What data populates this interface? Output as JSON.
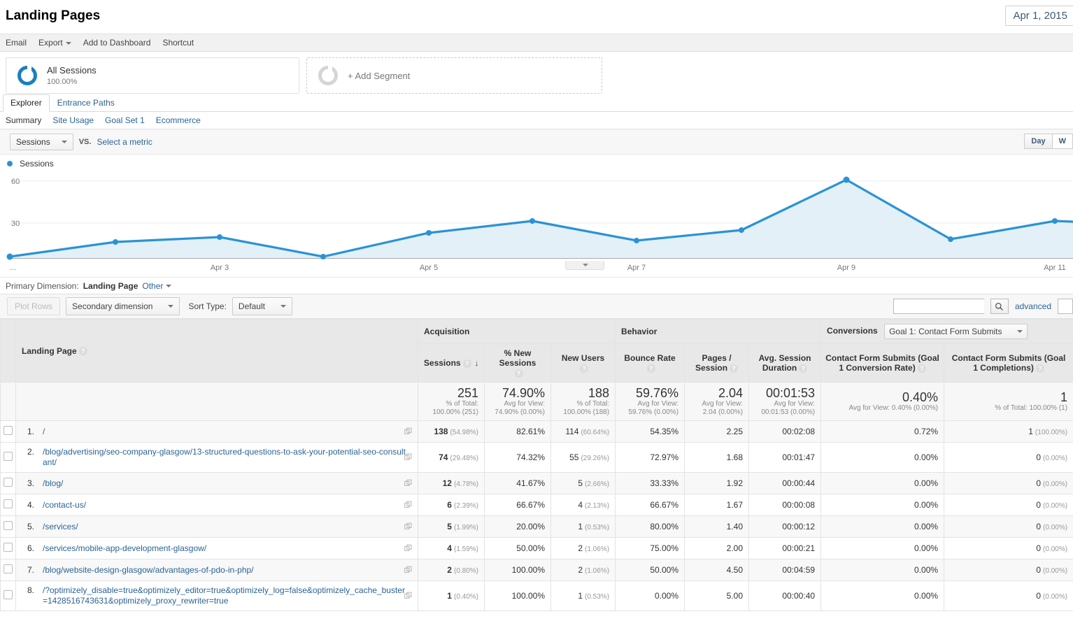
{
  "header": {
    "title": "Landing Pages",
    "date_range": "Apr 1, 2015"
  },
  "actions": [
    {
      "label": "Email",
      "icon": ""
    },
    {
      "label": "Export",
      "icon": "caret-down"
    },
    {
      "label": "Add to Dashboard",
      "icon": ""
    },
    {
      "label": "Shortcut",
      "icon": ""
    }
  ],
  "segments": {
    "all_sessions": {
      "name": "All Sessions",
      "percent": "100.00%"
    },
    "add_segment": {
      "label": "+ Add Segment"
    }
  },
  "tabs": [
    {
      "label": "Explorer",
      "active": true
    },
    {
      "label": "Entrance Paths",
      "active": false
    }
  ],
  "subtabs": [
    {
      "label": "Summary",
      "active": true
    },
    {
      "label": "Site Usage",
      "active": false
    },
    {
      "label": "Goal Set 1",
      "active": false
    },
    {
      "label": "Ecommerce",
      "active": false
    }
  ],
  "metric_bar": {
    "metric": "Sessions",
    "vs": "VS.",
    "select_metric": "Select a metric",
    "granularity": [
      {
        "label": "Day",
        "active": true
      },
      {
        "label": "W",
        "active": false
      }
    ]
  },
  "chart_data": {
    "type": "line",
    "title": "Sessions",
    "legend": [
      "Sessions"
    ],
    "legend_position": "top-left",
    "xlabel": "",
    "ylabel": "",
    "ylim": [
      0,
      75
    ],
    "yticks": [
      30,
      60
    ],
    "grid": true,
    "x": [
      "Apr 1",
      "Apr 2",
      "Apr 3",
      "Apr 4",
      "Apr 5",
      "Apr 6",
      "Apr 7",
      "Apr 8",
      "Apr 9",
      "Apr 10",
      "Apr 11"
    ],
    "xtick_labels": [
      "...",
      "Apr 3",
      "Apr 5",
      "Apr 7",
      "Apr 9",
      "Apr 11"
    ],
    "series": [
      {
        "name": "Sessions",
        "color": "#2a93d5",
        "values": [
          1,
          13,
          17,
          1,
          20,
          29,
          14,
          23,
          56,
          15,
          28
        ]
      }
    ]
  },
  "primary_dimension": {
    "label": "Primary Dimension:",
    "value": "Landing Page",
    "other": "Other"
  },
  "table_toolbar": {
    "plot_rows": "Plot Rows",
    "secondary_dimension": "Secondary dimension",
    "sort_type_label": "Sort Type:",
    "sort_type_value": "Default",
    "search_placeholder": "",
    "search_value": "",
    "advanced": "advanced"
  },
  "table": {
    "groups": [
      {
        "label": "Acquisition",
        "span": 3
      },
      {
        "label": "Behavior",
        "span": 3
      },
      {
        "label": "Conversions",
        "span": 2,
        "goal_select": "Goal 1: Contact Form Submits"
      }
    ],
    "dimension_header": "Landing Page",
    "columns": [
      "Sessions",
      "% New Sessions",
      "New Users",
      "Bounce Rate",
      "Pages / Session",
      "Avg. Session Duration",
      "Contact Form Submits (Goal 1 Conversion Rate)",
      "Contact Form Submits (Goal 1 Completions)"
    ],
    "sorted_column": "Sessions",
    "sort_direction": "desc",
    "summary": [
      {
        "value": "251",
        "note1": "% of Total:",
        "note2": "100.00% (251)"
      },
      {
        "value": "74.90%",
        "note1": "Avg for View:",
        "note2": "74.90% (0.00%)"
      },
      {
        "value": "188",
        "note1": "% of Total:",
        "note2": "100.00% (188)"
      },
      {
        "value": "59.76%",
        "note1": "Avg for View:",
        "note2": "59.76% (0.00%)"
      },
      {
        "value": "2.04",
        "note1": "Avg for View:",
        "note2": "2.04 (0.00%)"
      },
      {
        "value": "00:01:53",
        "note1": "Avg for View:",
        "note2": "00:01:53 (0.00%)"
      },
      {
        "value": "0.40%",
        "note1": "",
        "note2": "Avg for View: 0.40% (0.00%)"
      },
      {
        "value": "1",
        "note1": "",
        "note2": "% of Total: 100.00% (1)"
      }
    ],
    "rows": [
      {
        "index": "1.",
        "page": "/",
        "sessions": "138",
        "sessions_pct": "(54.98%)",
        "new_sessions_pct": "82.61%",
        "new_users": "114",
        "new_users_pct": "(60.64%)",
        "bounce_rate": "54.35%",
        "pages_session": "2.25",
        "avg_duration": "00:02:08",
        "goal_rate": "0.72%",
        "goal_completions": "1",
        "goal_completions_pct": "(100.00%)"
      },
      {
        "index": "2.",
        "page": "/blog/advertising/seo-company-glasgow/13-structured-questions-to-ask-your-potential-seo-consultant/",
        "sessions": "74",
        "sessions_pct": "(29.48%)",
        "new_sessions_pct": "74.32%",
        "new_users": "55",
        "new_users_pct": "(29.26%)",
        "bounce_rate": "72.97%",
        "pages_session": "1.68",
        "avg_duration": "00:01:47",
        "goal_rate": "0.00%",
        "goal_completions": "0",
        "goal_completions_pct": "(0.00%)"
      },
      {
        "index": "3.",
        "page": "/blog/",
        "sessions": "12",
        "sessions_pct": "(4.78%)",
        "new_sessions_pct": "41.67%",
        "new_users": "5",
        "new_users_pct": "(2.66%)",
        "bounce_rate": "33.33%",
        "pages_session": "1.92",
        "avg_duration": "00:00:44",
        "goal_rate": "0.00%",
        "goal_completions": "0",
        "goal_completions_pct": "(0.00%)"
      },
      {
        "index": "4.",
        "page": "/contact-us/",
        "sessions": "6",
        "sessions_pct": "(2.39%)",
        "new_sessions_pct": "66.67%",
        "new_users": "4",
        "new_users_pct": "(2.13%)",
        "bounce_rate": "66.67%",
        "pages_session": "1.67",
        "avg_duration": "00:00:08",
        "goal_rate": "0.00%",
        "goal_completions": "0",
        "goal_completions_pct": "(0.00%)"
      },
      {
        "index": "5.",
        "page": "/services/",
        "sessions": "5",
        "sessions_pct": "(1.99%)",
        "new_sessions_pct": "20.00%",
        "new_users": "1",
        "new_users_pct": "(0.53%)",
        "bounce_rate": "80.00%",
        "pages_session": "1.40",
        "avg_duration": "00:00:12",
        "goal_rate": "0.00%",
        "goal_completions": "0",
        "goal_completions_pct": "(0.00%)"
      },
      {
        "index": "6.",
        "page": "/services/mobile-app-development-glasgow/",
        "sessions": "4",
        "sessions_pct": "(1.59%)",
        "new_sessions_pct": "50.00%",
        "new_users": "2",
        "new_users_pct": "(1.06%)",
        "bounce_rate": "75.00%",
        "pages_session": "2.00",
        "avg_duration": "00:00:21",
        "goal_rate": "0.00%",
        "goal_completions": "0",
        "goal_completions_pct": "(0.00%)"
      },
      {
        "index": "7.",
        "page": "/blog/website-design-glasgow/advantages-of-pdo-in-php/",
        "sessions": "2",
        "sessions_pct": "(0.80%)",
        "new_sessions_pct": "100.00%",
        "new_users": "2",
        "new_users_pct": "(1.06%)",
        "bounce_rate": "50.00%",
        "pages_session": "4.50",
        "avg_duration": "00:04:59",
        "goal_rate": "0.00%",
        "goal_completions": "0",
        "goal_completions_pct": "(0.00%)"
      },
      {
        "index": "8.",
        "page": "/?optimizely_disable=true&optimizely_editor=true&optimizely_log=false&optimizely_cache_buster=1428516743631&optimizely_proxy_rewriter=true",
        "sessions": "1",
        "sessions_pct": "(0.40%)",
        "new_sessions_pct": "100.00%",
        "new_users": "1",
        "new_users_pct": "(0.53%)",
        "bounce_rate": "0.00%",
        "pages_session": "5.00",
        "avg_duration": "00:00:40",
        "goal_rate": "0.00%",
        "goal_completions": "0",
        "goal_completions_pct": "(0.00%)"
      }
    ]
  },
  "colors": {
    "accent": "#2a93d5",
    "link": "#2a6496",
    "chart_fill": "#e3f0f8"
  }
}
